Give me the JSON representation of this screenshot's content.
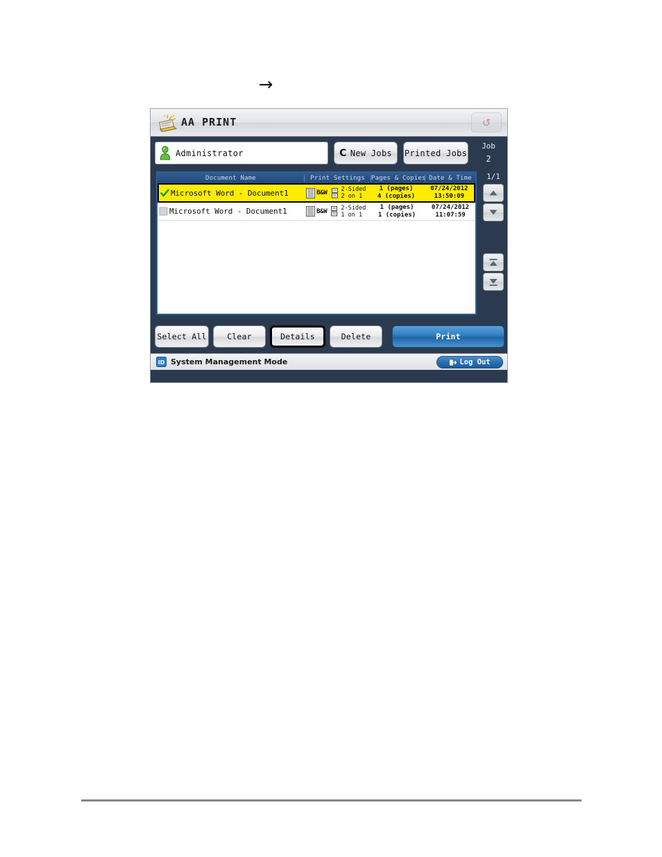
{
  "step_arrow": "→",
  "panel": {
    "titlebar": {
      "icon": "print-document-icon",
      "title": "AA PRINT",
      "help_button": {
        "icon": "help-icon",
        "glyph": "↺"
      }
    },
    "toolbar": {
      "user_field": {
        "avatar_icon": "user-avatar-icon",
        "user_name": "Administrator"
      },
      "new_jobs_label": "New Jobs",
      "new_jobs_icon": "refresh-icon",
      "new_jobs_glyph": "C",
      "printed_jobs_label": "Printed Jobs",
      "job_counter_label": "Job",
      "job_counter_value": "2"
    },
    "list": {
      "columns": [
        "Document Name",
        "Print Settings",
        "Pages & Copies",
        "Date & Time"
      ],
      "rows": [
        {
          "selected": true,
          "checked": true,
          "document_name": "Microsoft Word - Document1",
          "color_mode": "B&W",
          "duplex": "2-Sided",
          "nup": "2 on 1",
          "pages": "1 (pages)",
          "copies": "4 (copies)",
          "date": "07/24/2012",
          "time": "13:50:09"
        },
        {
          "selected": false,
          "checked": false,
          "document_name": "Microsoft Word - Document1",
          "color_mode": "B&W",
          "duplex": "2-Sided",
          "nup": "1 on 1",
          "pages": "1 (pages)",
          "copies": "1 (copies)",
          "date": "07/24/2012",
          "time": "11:07:59"
        }
      ],
      "page_indicator": "1/1",
      "nav_buttons": [
        "scroll-up-icon",
        "scroll-down-icon",
        "scroll-first-icon",
        "scroll-last-icon"
      ]
    },
    "actions": {
      "select_all": "Select All",
      "clear": "Clear",
      "details": "Details",
      "delete": "Delete",
      "print": "Print"
    },
    "statusbar": {
      "id_icon": "id-badge-icon",
      "id_text": "ID",
      "mode_text": "System Management Mode",
      "logout_label": "Log Out",
      "logout_icon": "logout-icon"
    }
  },
  "colors": {
    "panel_bg": "#2b3a4f",
    "header_blue": "#2f5c92",
    "selected_row": "#ffec00",
    "print_button": "#2f7ec2",
    "logout_button": "#2a6fb0",
    "focus_outline": "#000000"
  }
}
